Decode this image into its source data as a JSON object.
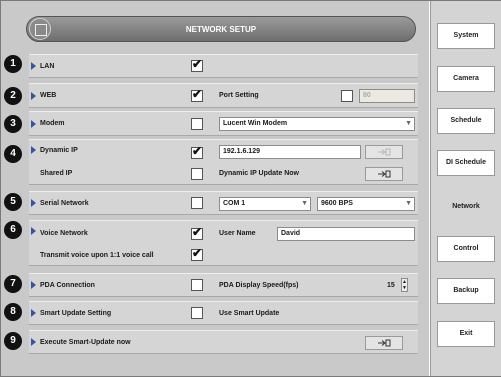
{
  "header": {
    "title": "NETWORK SETUP"
  },
  "sidebar": {
    "items": [
      {
        "label": "System"
      },
      {
        "label": "Camera"
      },
      {
        "label": "Schedule"
      },
      {
        "label": "DI Schedule"
      },
      {
        "label": "Network",
        "active": true
      },
      {
        "label": "Control"
      },
      {
        "label": "Backup"
      },
      {
        "label": "Exit"
      }
    ]
  },
  "rows": {
    "lan": {
      "number": "1",
      "label": "LAN",
      "checked": true
    },
    "web": {
      "number": "2",
      "label": "WEB",
      "checked": true,
      "port_setting_label": "Port Setting",
      "port_checked": false,
      "port_value": "80"
    },
    "modem": {
      "number": "3",
      "label": "Modem",
      "checked": false,
      "selected": "Lucent Win Modem"
    },
    "dynamic_ip": {
      "number": "4",
      "label": "Dynamic IP",
      "checked": true,
      "ip_value": "192.1.6.129",
      "shared_ip_label": "Shared IP",
      "shared_checked": false,
      "update_label": "Dynamic IP Update Now"
    },
    "serial": {
      "number": "5",
      "label": "Serial Network",
      "checked": false,
      "port_selected": "COM 1",
      "baud_selected": "9600 BPS"
    },
    "voice": {
      "number": "6",
      "label": "Voice Network",
      "checked": true,
      "user_name_label": "User Name",
      "user_name_value": "David",
      "transmit_label": "Transmit voice upon 1:1 voice call",
      "transmit_checked": true
    },
    "pda": {
      "number": "7",
      "label": "PDA Connection",
      "checked": false,
      "speed_label": "PDA Display Speed(fps)",
      "speed_value": "15"
    },
    "smart": {
      "number": "8",
      "label": "Smart Update Setting",
      "checked": false,
      "use_label": "Use Smart Update"
    },
    "execute": {
      "number": "9",
      "label": "Execute Smart-Update now"
    }
  },
  "icons": {
    "check": "✔",
    "caret": "▼",
    "spin_up": "▲",
    "spin_down": "▼"
  }
}
